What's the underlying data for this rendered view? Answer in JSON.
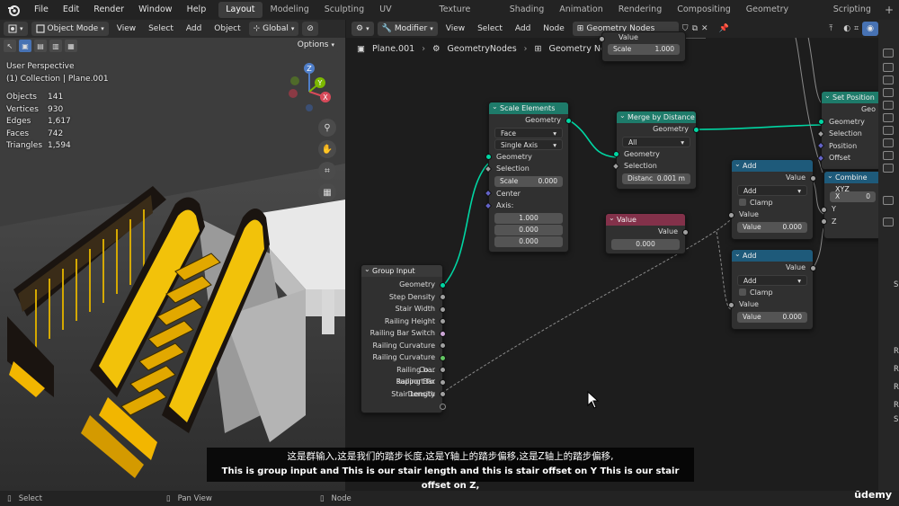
{
  "menubar": {
    "items": [
      "File",
      "Edit",
      "Render",
      "Window",
      "Help"
    ],
    "workspaces": [
      "Layout",
      "Modeling",
      "Sculpting",
      "UV Editing",
      "Texture Paint",
      "Shading",
      "Animation",
      "Rendering",
      "Compositing",
      "Geometry Nodes",
      "Scripting"
    ],
    "active_workspace": "Layout",
    "add_tab": "+"
  },
  "viewport": {
    "mode": "Object Mode",
    "menus": [
      "View",
      "Select",
      "Add",
      "Object"
    ],
    "orientation": "Global",
    "options_label": "Options",
    "info_line1": "User Perspective",
    "info_line2": "(1) Collection | Plane.001",
    "stats": [
      {
        "label": "Objects",
        "value": "141"
      },
      {
        "label": "Vertices",
        "value": "930"
      },
      {
        "label": "Edges",
        "value": "1,617"
      },
      {
        "label": "Faces",
        "value": "742"
      },
      {
        "label": "Triangles",
        "value": "1,594"
      }
    ],
    "gizmo_axes": {
      "x": "X",
      "y": "Y",
      "z": "Z"
    }
  },
  "node_editor": {
    "editor_type": "Modifier",
    "menus": [
      "View",
      "Select",
      "Add",
      "Node"
    ],
    "tree_name": "Geometry Nodes",
    "breadcrumb": [
      "Plane.001",
      "GeometryNodes",
      "Geometry Nodes"
    ],
    "nodes": {
      "top_partial": {
        "label": "Value",
        "field_label": "Scale",
        "field_value": "1.000"
      },
      "scale_elements": {
        "title": "Scale Elements",
        "out_geometry": "Geometry",
        "domain": "Face",
        "scale_mode": "Single Axis",
        "in_geometry": "Geometry",
        "selection": "Selection",
        "scale_label": "Scale",
        "scale_value": "0.000",
        "center": "Center",
        "axis": "Axis:",
        "axis_values": [
          "1.000",
          "0.000",
          "0.000"
        ]
      },
      "merge_by_distance": {
        "title": "Merge by Distance",
        "out_geometry": "Geometry",
        "mode": "All",
        "in_geometry": "Geometry",
        "selection": "Selection",
        "distance_label": "Distanc",
        "distance_value": "0.001 m"
      },
      "set_position": {
        "title": "Set Position",
        "out_partial": "Geo",
        "in_geometry": "Geometry",
        "selection": "Selection",
        "position": "Position",
        "offset": "Offset"
      },
      "add1": {
        "title": "Add",
        "out": "Value",
        "op": "Add",
        "clamp": "Clamp",
        "in": "Value",
        "field_label": "Value",
        "field_value": "0.000"
      },
      "add2": {
        "title": "Add",
        "out": "Value",
        "op": "Add",
        "clamp": "Clamp",
        "in": "Value",
        "field_label": "Value",
        "field_value": "0.000"
      },
      "value_node": {
        "title": "Value",
        "out": "Value",
        "value": "0.000"
      },
      "combine_xyz": {
        "title": "Combine XYZ",
        "x_label": "X",
        "x_value": "0",
        "y": "Y",
        "z": "Z"
      },
      "group_input": {
        "title": "Group Input",
        "outputs": [
          "Geometry",
          "Step Density",
          "Stair Width",
          "Railing Height",
          "Railing Bar Switch",
          "Railing Curvature",
          "Railing Curvature Co...",
          "Railing bar support fix",
          "Railing Bar Density",
          "Stair Length"
        ]
      }
    }
  },
  "statusbar": {
    "left": "Select",
    "middle": "Pan View",
    "right": "Node"
  },
  "subtitle": {
    "chinese": "这是群输入,这是我们的踏步长度,这是Y轴上的踏步偏移,这是Z轴上的踏步偏移,",
    "english": "This is group input and This is our stair length and this is stair offset on Y This is our stair offset on Z,"
  },
  "watermark": "ūdemy",
  "right_strip_letters": [
    "S",
    "R",
    "R",
    "R",
    "R",
    "S"
  ],
  "colors": {
    "geometry_socket": "#00d6a3",
    "geo_header": "#1e7b6a",
    "math_header": "#1e5a7a",
    "value_header": "#83314a",
    "active_tab": "#3d3d3d"
  }
}
